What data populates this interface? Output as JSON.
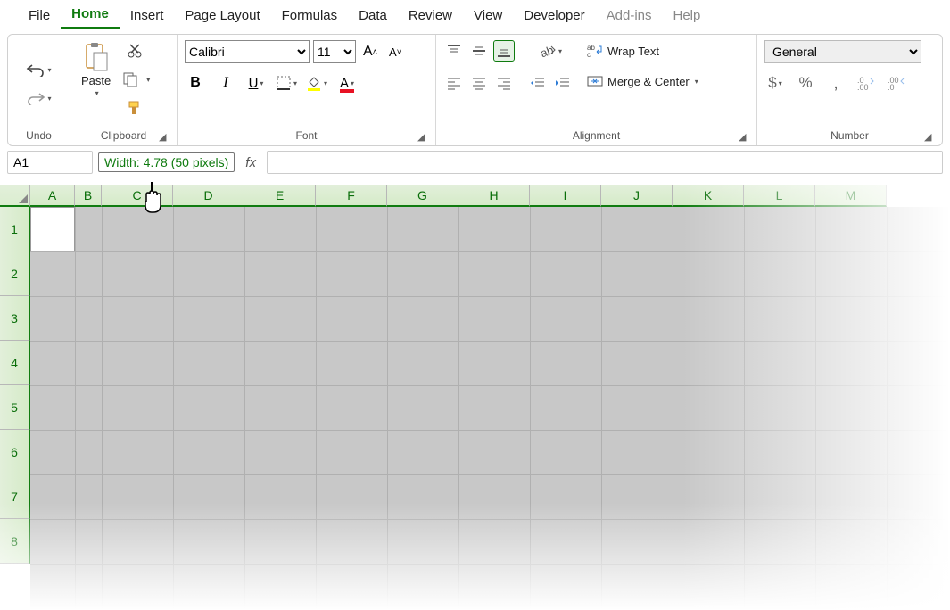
{
  "tabs": {
    "file": "File",
    "home": "Home",
    "insert": "Insert",
    "page_layout": "Page Layout",
    "formulas": "Formulas",
    "data": "Data",
    "review": "Review",
    "view": "View",
    "developer": "Developer",
    "addins": "Add-ins",
    "help": "Help"
  },
  "ribbon": {
    "undo_label": "Undo",
    "clipboard_label": "Clipboard",
    "paste_label": "Paste",
    "font_label": "Font",
    "font_name": "Calibri",
    "font_size": "11",
    "alignment_label": "Alignment",
    "wrap_text": "Wrap Text",
    "merge_center": "Merge & Center",
    "number_label": "Number",
    "number_format": "General"
  },
  "formula_bar": {
    "cell_ref": "A1",
    "tooltip": "Width: 4.78 (50 pixels)",
    "formula": ""
  },
  "grid": {
    "cols": [
      "A",
      "B",
      "C",
      "D",
      "E",
      "F",
      "G",
      "H",
      "I",
      "J",
      "K",
      "L",
      "M"
    ],
    "rows": [
      "1",
      "2",
      "3",
      "4",
      "5",
      "6",
      "7",
      "8"
    ]
  }
}
